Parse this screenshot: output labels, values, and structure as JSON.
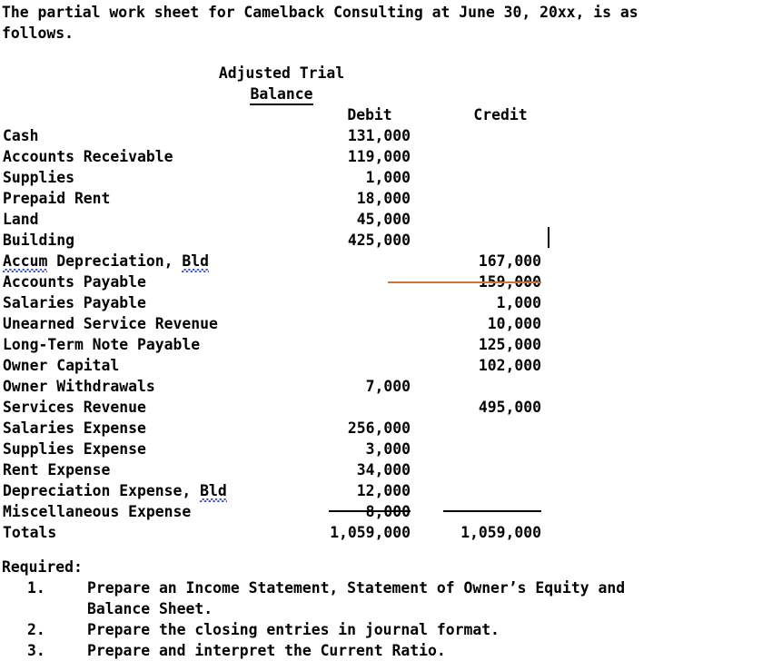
{
  "document": {
    "intro": "The partial work sheet for Camelback Consulting at June 30, 20xx, is as\nfollows."
  },
  "worksheet": {
    "header": {
      "title_line1": "Adjusted Trial",
      "title_line2": "Balance",
      "col_debit": "Debit",
      "col_credit": "Credit"
    },
    "rows": [
      {
        "label": "Cash",
        "debit": "131,000",
        "credit": ""
      },
      {
        "label": "Accounts Receivable",
        "debit": "119,000",
        "credit": ""
      },
      {
        "label": "Supplies",
        "debit": "1,000",
        "credit": ""
      },
      {
        "label": "Prepaid Rent",
        "debit": "18,000",
        "credit": ""
      },
      {
        "label": "Land",
        "debit": "45,000",
        "credit": ""
      },
      {
        "label": "Building",
        "debit": "425,000",
        "credit": ""
      },
      {
        "label": "Accum Depreciation, Bld",
        "label_pre": "",
        "label_misspelled1": "Accum",
        "label_mid": " Depreciation, ",
        "label_misspelled2": "Bld",
        "debit": "",
        "credit": "167,000"
      },
      {
        "label": "Accounts Payable",
        "debit": "",
        "credit": "159,000"
      },
      {
        "label": "Salaries Payable",
        "debit": "",
        "credit": "1,000"
      },
      {
        "label": "Unearned Service Revenue",
        "debit": "",
        "credit": "10,000"
      },
      {
        "label": "Long-Term Note Payable",
        "debit": "",
        "credit": "125,000"
      },
      {
        "label": "Owner Capital",
        "debit": "",
        "credit": "102,000"
      },
      {
        "label": "Owner Withdrawals",
        "debit": "7,000",
        "credit": ""
      },
      {
        "label": "Services Revenue",
        "debit": "",
        "credit": "495,000"
      },
      {
        "label": "Salaries Expense",
        "debit": "256,000",
        "credit": ""
      },
      {
        "label": "Supplies Expense",
        "debit": "3,000",
        "credit": ""
      },
      {
        "label": "Rent Expense",
        "debit": "34,000",
        "credit": ""
      },
      {
        "label": "Depreciation Expense, Bld",
        "label_mid": "Depreciation Expense, ",
        "label_misspelled2": "Bld",
        "debit": "12,000",
        "credit": ""
      },
      {
        "label": "Miscellaneous Expense",
        "debit": "8,000",
        "credit": ""
      }
    ],
    "totals": {
      "label": "Totals",
      "debit": "1,059,000",
      "credit": "1,059,000"
    }
  },
  "required": {
    "heading": "Required:",
    "items": [
      {
        "num": "1.",
        "text": "Prepare an Income Statement, Statement of Owner’s Equity and\nBalance Sheet."
      },
      {
        "num": "2.",
        "text": "Prepare the closing entries in journal format."
      },
      {
        "num": "3.",
        "text": "Prepare and interpret the Current Ratio."
      }
    ]
  },
  "annotations": {
    "highlight_rule_color": "#c8763c",
    "spellcheck_color": "#3b4fc4"
  }
}
